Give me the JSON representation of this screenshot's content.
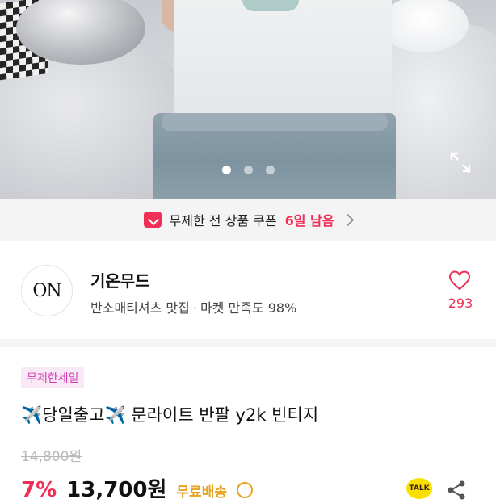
{
  "hero": {
    "slide_count": 3,
    "active_slide": 1,
    "expand_icon": "expand-icon"
  },
  "coupon": {
    "icon": "coupon-ticket-icon",
    "text": "무제한 전 상품 쿠폰",
    "days_left": "6일 남음"
  },
  "seller": {
    "avatar_text": "ON",
    "name": "기온무드",
    "tagline": "반소매티셔츠 맛집",
    "separator": "·",
    "satisfaction": "마켓 만족도 98%",
    "like_icon": "heart-icon",
    "likes": "293"
  },
  "product": {
    "badge": "무제한세일",
    "title_emoji": "✈️",
    "title_part1": "당일출고",
    "title_part2": "문라이트 반팔 y2k 빈티지",
    "original_price": "14,800원",
    "discount": "7%",
    "price": "13,700원",
    "shipping": "무료배송",
    "talk_label": "TALK",
    "share_icon": "share-icon"
  },
  "colors": {
    "accent": "#ef2f55",
    "badge_text": "#d53bb0",
    "badge_bg": "#f9e8f6",
    "shipping": "#e7a321",
    "talk_bg": "#f9e000"
  }
}
